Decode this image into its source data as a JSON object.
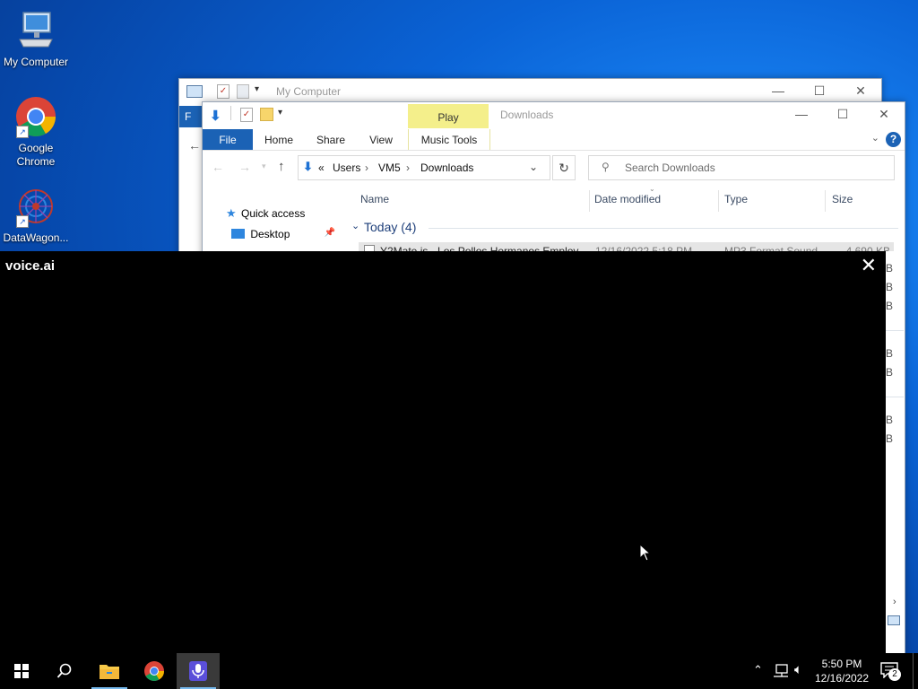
{
  "desktop": {
    "icons": [
      {
        "label": "My Computer",
        "icon": "computer-icon"
      },
      {
        "label": "Google Chrome",
        "icon": "chrome-icon"
      },
      {
        "label": "DataWagon...",
        "icon": "datawagon-icon"
      }
    ]
  },
  "back_window": {
    "title": "My Computer",
    "file_tab": "F"
  },
  "explorer": {
    "title": "Downloads",
    "context_tab": "Play",
    "tabs": [
      "File",
      "Home",
      "Share",
      "View",
      "Music Tools"
    ],
    "breadcrumb": {
      "prefix": "«",
      "parts": [
        "Users",
        "VM5",
        "Downloads"
      ]
    },
    "search_placeholder": "Search Downloads",
    "columns": [
      "Name",
      "Date modified",
      "Type",
      "Size"
    ],
    "nav": [
      {
        "label": "Quick access",
        "icon": "star-icon"
      },
      {
        "label": "Desktop",
        "icon": "desktop-folder-icon"
      }
    ],
    "group": {
      "label": "Today (4)"
    },
    "files": [
      {
        "name": "Y2Mate.is - Los Pollos Hermanos Employ...",
        "date": "12/16/2022 5:18 PM",
        "type": "MP3 Format Sound",
        "size": "4,690 KB"
      }
    ],
    "partial_size_suffix": "B"
  },
  "voice_app": {
    "title": "voice.ai"
  },
  "taskbar": {
    "time": "5:50 PM",
    "date": "12/16/2022",
    "notification_count": "2"
  },
  "colors": {
    "accent": "#1b62b5",
    "play_tab": "#f4ef8b",
    "desktop": "#0a63d6"
  }
}
